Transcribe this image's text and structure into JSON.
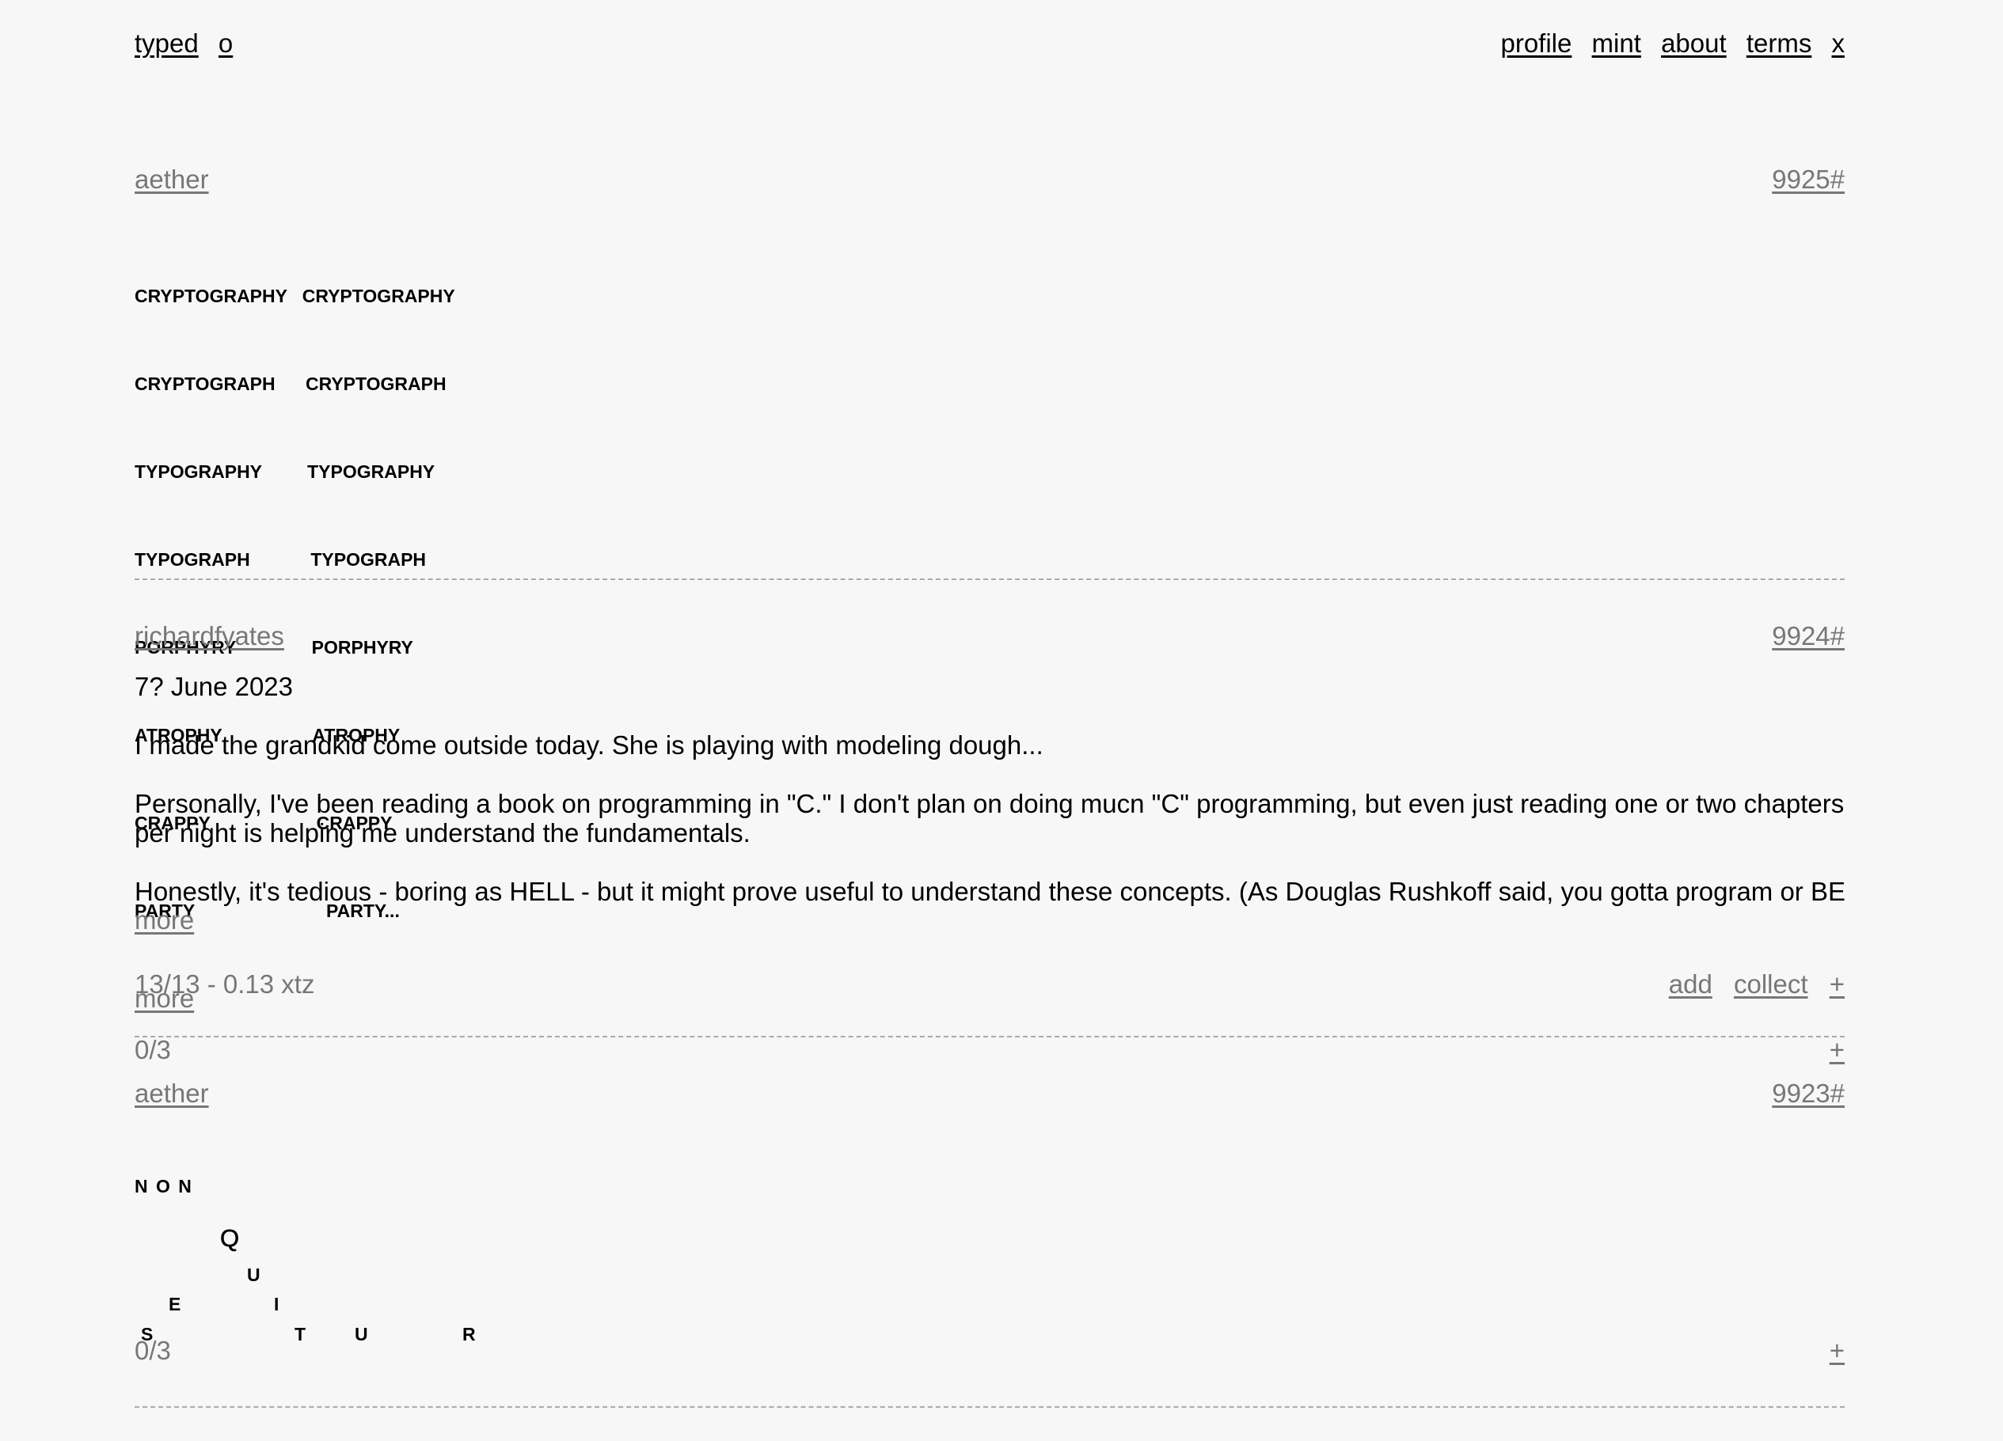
{
  "nav": {
    "left": [
      {
        "label": "typed"
      },
      {
        "label": "o"
      }
    ],
    "right": [
      {
        "label": "profile"
      },
      {
        "label": "mint"
      },
      {
        "label": "about"
      },
      {
        "label": "terms"
      },
      {
        "label": "x"
      }
    ]
  },
  "posts": [
    {
      "author": "aether",
      "id": "9925#",
      "poem_lines": [
        "CRYPTOGRAPHY   CRYPTOGRAPHY",
        "CRYPTOGRAPH      CRYPTOGRAPH",
        "TYPOGRAPHY         TYPOGRAPHY",
        "TYPOGRAPH            TYPOGRAPH",
        "PORPHYRY               PORPHYRY",
        "ATROPHY                  ATROPHY",
        "CRAPPY                     CRAPPY",
        "PARTY                          PARTY..."
      ],
      "more_label": "more",
      "stats": "0/3",
      "actions": [
        {
          "label": "+",
          "icon": "plus-icon"
        }
      ]
    },
    {
      "author": "richardfyates",
      "id": "9924#",
      "paragraphs": [
        "7? June 2023",
        "I made the grandkid come outside today. She is playing with modeling dough...",
        "Personally, I've been reading a book on programming in \"C.\" I don't plan on doing mucn \"C\" programming, but even just reading one or two chapters per night is helping me understand the fundamentals.",
        "Honestly, it's tedious - boring as HELL - but it might prove useful to understand these concepts. (As Douglas Rushkoff said, you gotta program or BE …"
      ],
      "more_label": "more",
      "stats": "13/13 - 0.13 xtz",
      "actions": [
        {
          "label": "add"
        },
        {
          "label": "collect"
        },
        {
          "label": "+",
          "icon": "plus-icon"
        }
      ]
    },
    {
      "author": "aether",
      "id": "9923#",
      "scatter_letters": [
        "N O N",
        "Q",
        "U",
        "E",
        "I",
        "S",
        "T",
        "U",
        "R"
      ],
      "stats": "0/3",
      "actions": [
        {
          "label": "+",
          "icon": "plus-icon"
        }
      ]
    }
  ]
}
